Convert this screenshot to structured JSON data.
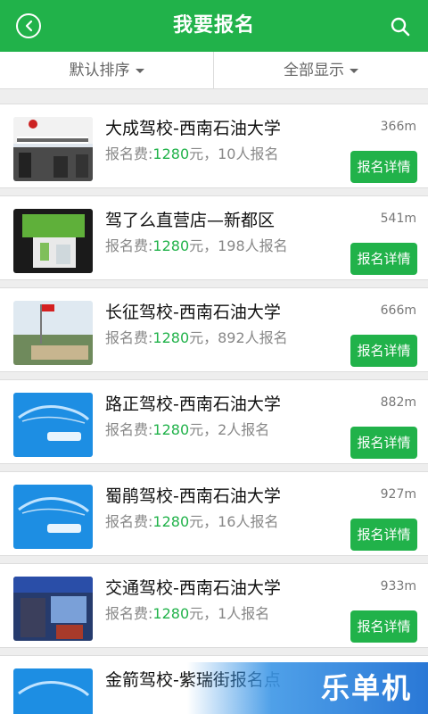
{
  "header": {
    "title": "我要报名",
    "icons": [
      "back-icon",
      "search-icon"
    ]
  },
  "filters": {
    "sort_label": "默认排序",
    "display_label": "全部显示"
  },
  "colors": {
    "brand_green": "#21b24a",
    "price_green": "#21b24a"
  },
  "list": {
    "items": [
      {
        "name": "大成驾校-西南石油大学",
        "distance": "366m",
        "fee_label": "报名费:",
        "price": "1280",
        "suffix": "元，10人报名",
        "button": "报名详情"
      },
      {
        "name": "驾了么直营店—新都区",
        "distance": "541m",
        "fee_label": "报名费:",
        "price": "1280",
        "suffix": "元，198人报名",
        "button": "报名详情"
      },
      {
        "name": "长征驾校-西南石油大学",
        "distance": "666m",
        "fee_label": "报名费:",
        "price": "1280",
        "suffix": "元，892人报名",
        "button": "报名详情"
      },
      {
        "name": "路正驾校-西南石油大学",
        "distance": "882m",
        "fee_label": "报名费:",
        "price": "1280",
        "suffix": "元，2人报名",
        "button": "报名详情"
      },
      {
        "name": "蜀鹃驾校-西南石油大学",
        "distance": "927m",
        "fee_label": "报名费:",
        "price": "1280",
        "suffix": "元，16人报名",
        "button": "报名详情"
      },
      {
        "name": "交通驾校-西南石油大学",
        "distance": "933m",
        "fee_label": "报名费:",
        "price": "1280",
        "suffix": "元，1人报名",
        "button": "报名详情"
      },
      {
        "name": "金箭驾校-紫瑞街报名点",
        "distance": "",
        "fee_label": "",
        "price": "",
        "suffix": "",
        "button": ""
      }
    ]
  },
  "watermark": {
    "text": "乐单机"
  }
}
